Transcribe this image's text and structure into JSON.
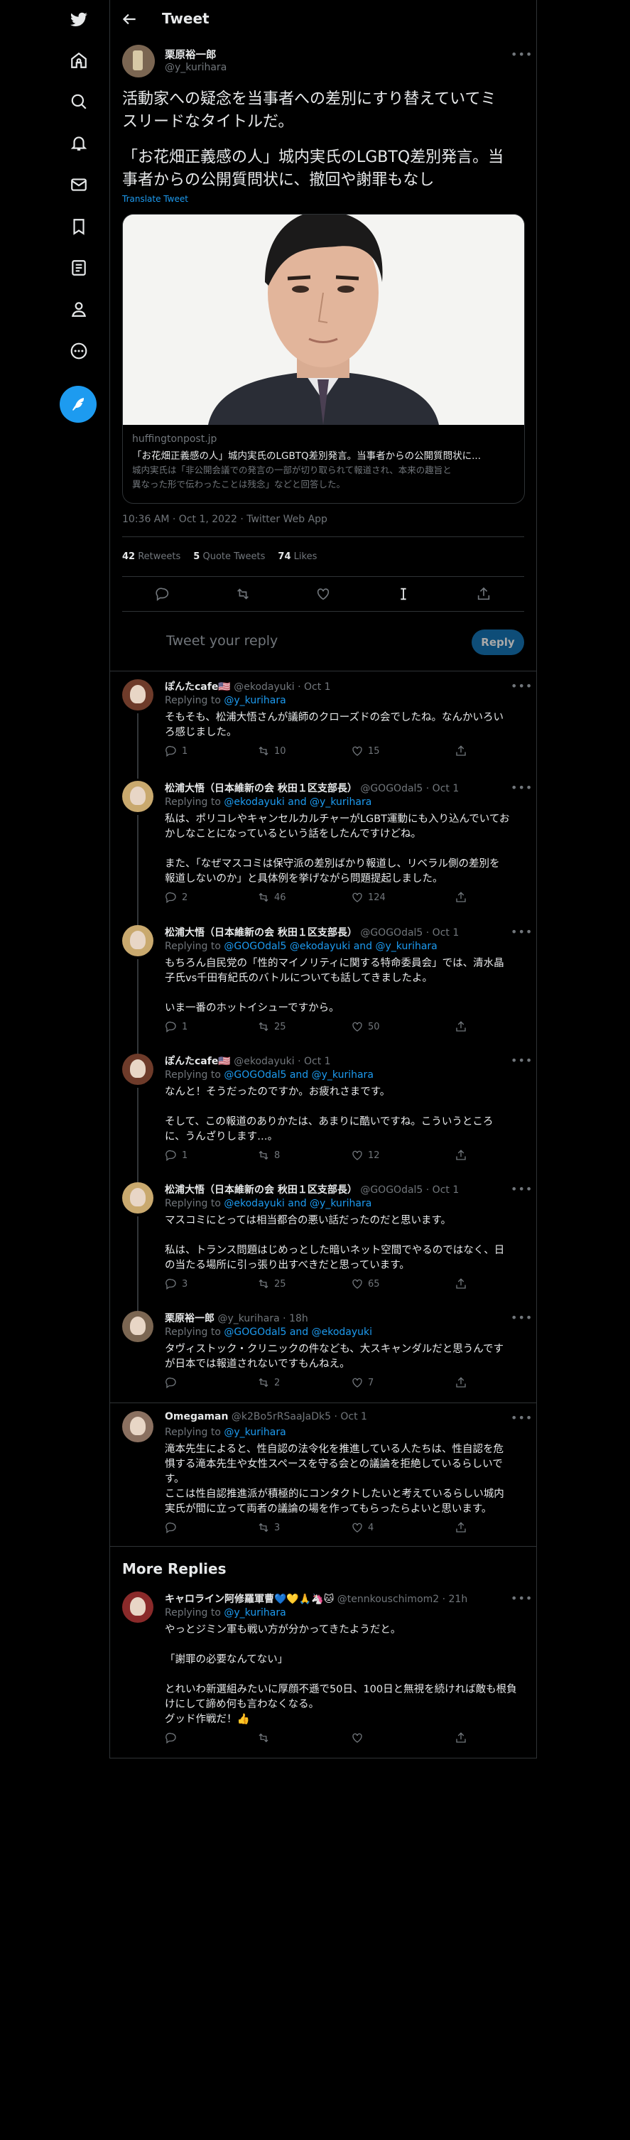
{
  "sidebar": {
    "icons": [
      "twitter-logo-icon",
      "home-icon",
      "explore-icon",
      "notifications-icon",
      "messages-icon",
      "bookmarks-icon",
      "lists-icon",
      "profile-icon",
      "more-icon"
    ],
    "compose_icon": "compose-tweet-icon"
  },
  "header": {
    "title": "Tweet"
  },
  "main_tweet": {
    "author_name": "栗原裕一郎",
    "author_handle": "@y_kurihara",
    "text_line1": "活動家への疑念を当事者への差別にすり替えていてミ",
    "text_line2": "スリードなタイトルだ。",
    "text_line3": "「お花畑正義感の人」城内実氏のLGBTQ差別発言。当",
    "text_line4": "事者からの公開質問状に、撤回や謝罪もなし",
    "translate": "Translate Tweet",
    "card": {
      "domain": "huffingtonpost.jp",
      "title": "「お花畑正義感の人」城内実氏のLGBTQ差別発言。当事者からの公開質問状に...",
      "desc_line1": "城内実氏は「非公開会議での発言の一部が切り取られて報道され、本来の趣旨と",
      "desc_line2": "異なった形で伝わったことは残念」などと回答した。"
    },
    "timestamp": "10:36 AM · Oct 1, 2022 · Twitter Web App",
    "stats": {
      "retweets_num": "42",
      "retweets_label": "Retweets",
      "quotes_num": "5",
      "quotes_label": "Quote Tweets",
      "likes_num": "74",
      "likes_label": "Likes"
    }
  },
  "composer": {
    "placeholder": "Tweet your reply",
    "reply_label": "Reply"
  },
  "replies": [
    {
      "name": "ぽんたcafe🇺🇸",
      "handle": "@ekodayuki · Oct 1",
      "replying_prefix": "Replying to ",
      "replying_to": "@y_kurihara",
      "lines": [
        "そもそも、松浦大悟さんが議師のクローズドの会でしたね。なんかいろい",
        "ろ感じました。"
      ],
      "replies": "1",
      "retweets": "10",
      "likes": "15"
    },
    {
      "name": "松浦大悟（日本維新の会 秋田１区支部長）",
      "handle": "@GOGOdal5 · Oct 1",
      "replying_prefix": "Replying to ",
      "replying_to": "@ekodayuki and @y_kurihara",
      "lines": [
        "私は、ポリコレやキャンセルカルチャーがLGBT運動にも入り込んでいてお",
        "かしなことになっているという話をしたんですけどね。",
        "",
        "また、「なぜマスコミは保守派の差別ばかり報道し、リベラル側の差別を",
        "報道しないのか」と具体例を挙げながら問題提起しました。"
      ],
      "replies": "2",
      "retweets": "46",
      "likes": "124"
    },
    {
      "name": "松浦大悟（日本維新の会 秋田１区支部長）",
      "handle": "@GOGOdal5 · Oct 1",
      "replying_prefix": "Replying to ",
      "replying_to": "@GOGOdal5 @ekodayuki and @y_kurihara",
      "lines": [
        "もちろん自民党の「性的マイノリティに関する特命委員会」では、清水晶",
        "子氏vs千田有紀氏のバトルについても話してきましたよ。",
        "",
        "いま一番のホットイシューですから。"
      ],
      "replies": "1",
      "retweets": "25",
      "likes": "50"
    },
    {
      "name": "ぽんたcafe🇺🇸",
      "handle": "@ekodayuki · Oct 1",
      "replying_prefix": "Replying to ",
      "replying_to": "@GOGOdal5 and @y_kurihara",
      "lines": [
        "なんと！そうだったのですか。お疲れさまです。",
        "",
        "そして、この報道のありかたは、あまりに酷いですね。こういうところ",
        "に、うんざりします…。"
      ],
      "replies": "1",
      "retweets": "8",
      "likes": "12"
    },
    {
      "name": "松浦大悟（日本維新の会 秋田１区支部長）",
      "handle": "@GOGOdal5 · Oct 1",
      "replying_prefix": "Replying to ",
      "replying_to": "@ekodayuki and @y_kurihara",
      "lines": [
        "マスコミにとっては相当都合の悪い話だったのだと思います。",
        "",
        "私は、トランス問題はじめっとした暗いネット空間でやるのではなく、日",
        "の当たる場所に引っ張り出すべきだと思っています。"
      ],
      "replies": "3",
      "retweets": "25",
      "likes": "65"
    },
    {
      "name": "栗原裕一郎",
      "handle": "@y_kurihara · 18h",
      "replying_prefix": "Replying to ",
      "replying_to": "@GOGOdal5 and @ekodayuki",
      "lines": [
        "タヴィストック・クリニックの件なども、大スキャンダルだと思うんです",
        "が日本では報道されないですもんねえ。"
      ],
      "replies": "",
      "retweets": "2",
      "likes": "7"
    },
    {
      "name": "Omegaman",
      "handle": "@k2Bo5rRSaaJaDk5 · Oct 1",
      "replying_prefix": "Replying to ",
      "replying_to": "@y_kurihara",
      "lines": [
        "滝本先生によると、性自認の法令化を推進している人たちは、性自認を危",
        "惧する滝本先生や女性スペースを守る会との議論を拒絶しているらしいで",
        "す。",
        "ここは性自認推進派が積極的にコンタクトしたいと考えているらしい城内",
        "実氏が間に立って両者の議論の場を作ってもらったらよいと思います。"
      ],
      "replies": "",
      "retweets": "3",
      "likes": "4"
    }
  ],
  "more_replies": {
    "heading": "More Replies",
    "tweet": {
      "name": "キャロライン阿修羅軍曹💙💛🙏🦄🐱",
      "handle": "@tennkouschimom2 · 21h",
      "replying_prefix": "Replying to ",
      "replying_to": "@y_kurihara",
      "lines": [
        "やっとジミン軍も戦い方が分かってきたようだと。",
        "",
        "「謝罪の必要なんてない」",
        "",
        "とれいわ新選組みたいに厚顔不遜で50日、100日と無視を続ければ敵も根負",
        "けにして諦め何も言わなくなる。",
        "グッド作戦だ！👍"
      ],
      "replies": "",
      "retweets": "",
      "likes": ""
    }
  }
}
